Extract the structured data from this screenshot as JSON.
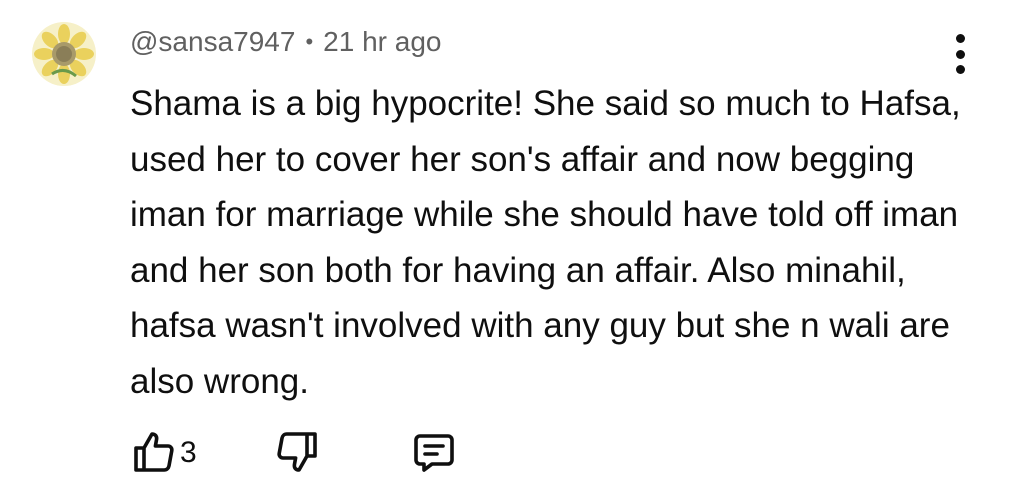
{
  "comment": {
    "author": "@sansa7947",
    "separator": "•",
    "time": "21 hr ago",
    "text": "Shama is a big hypocrite! She said so much to Hafsa, used her to cover her son's affair and now begging iman for marriage while she should have told off iman and her son both for having an affair. Also minahil, hafsa wasn't involved with any guy but she n wali are also wrong.",
    "like_count": "3"
  },
  "icons": {
    "avatar": "sunflower-avatar",
    "menu": "more-vertical-icon",
    "like": "thumbs-up-icon",
    "dislike": "thumbs-down-icon",
    "reply": "reply-comment-icon"
  }
}
